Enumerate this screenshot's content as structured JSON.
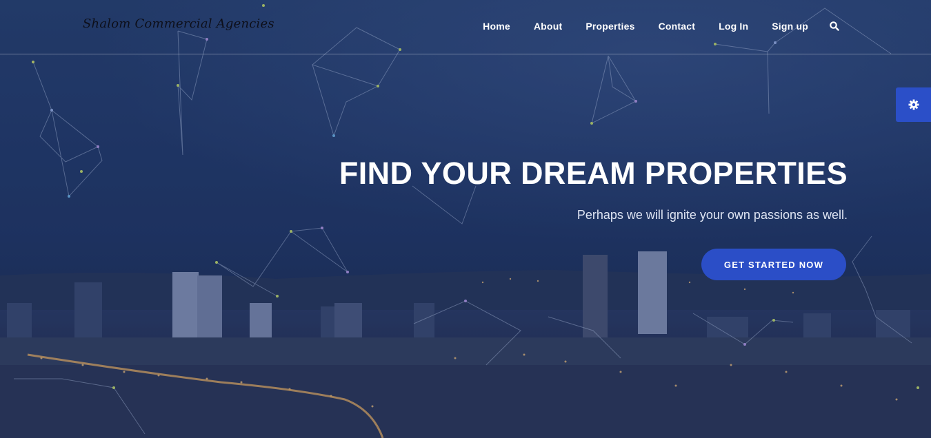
{
  "brand": {
    "name": "Shalom Commercial Agencies"
  },
  "nav": {
    "items": [
      {
        "label": "Home"
      },
      {
        "label": "About"
      },
      {
        "label": "Properties"
      },
      {
        "label": "Contact"
      },
      {
        "label": "Log In"
      },
      {
        "label": "Sign up"
      }
    ],
    "search_icon": "search-icon"
  },
  "settings": {
    "icon": "gear-icon"
  },
  "hero": {
    "title": "FIND YOUR DREAM PROPERTIES",
    "subtitle": "Perhaps we will ignite your own passions as well.",
    "cta_label": "GET STARTED NOW"
  },
  "colors": {
    "accent": "#2b4ec7",
    "text": "#ffffff",
    "brand_text": "#0d0f1a",
    "background": "#1f3563"
  }
}
